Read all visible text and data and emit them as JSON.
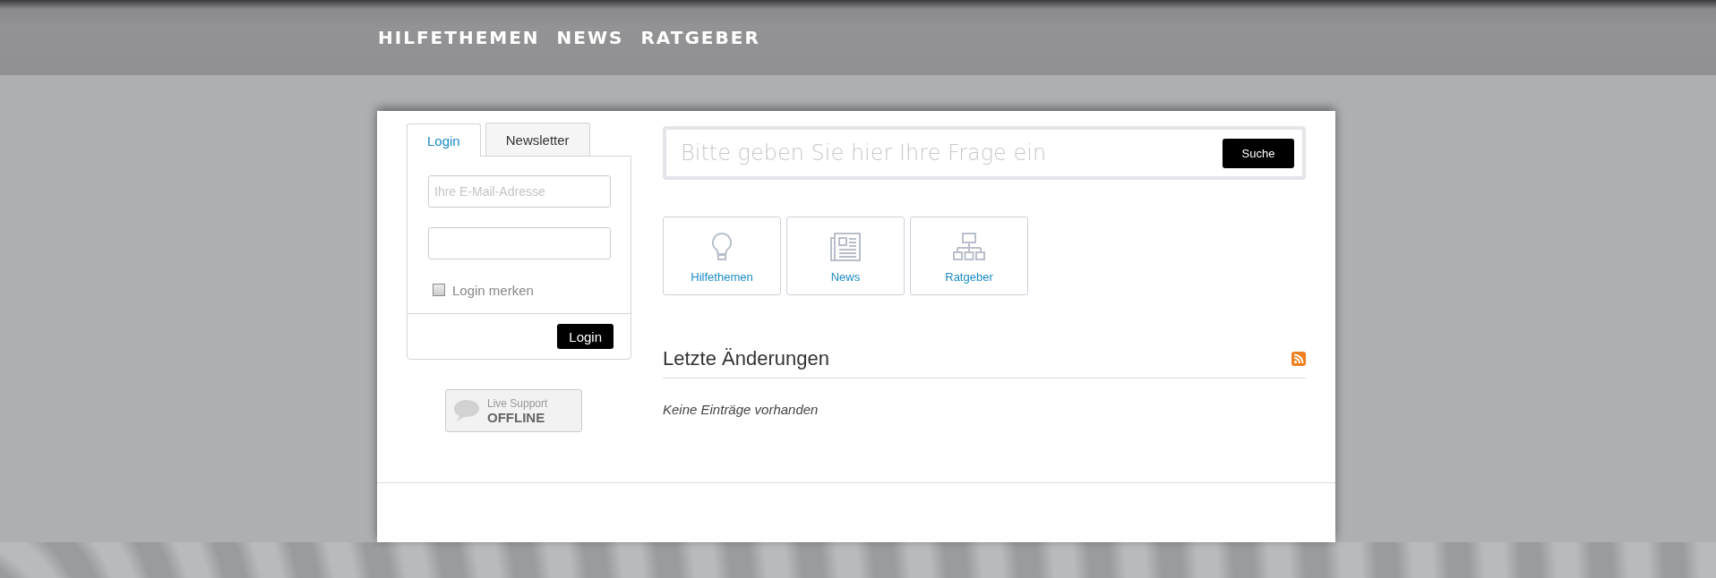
{
  "nav": [
    "HILFETHEMEN",
    "NEWS",
    "RATGEBER"
  ],
  "login_box": {
    "tabs": [
      {
        "label": "Login",
        "selected": true
      },
      {
        "label": "Newsletter",
        "selected": false
      }
    ],
    "email": {
      "placeholder": "Ihre E-Mail-Adresse"
    },
    "remember": {
      "label": "Login merken",
      "checked": false
    },
    "button": "Login"
  },
  "live_support": {
    "line_1": "Live Support",
    "line_2": "OFFLINE"
  },
  "search": {
    "placeholder": "Bitte geben Sie hier Ihre Frage ein",
    "button": "Suche"
  },
  "tiles": [
    "Hilfethemen",
    "News",
    "Ratgeber"
  ],
  "changes": {
    "title": "Letzte Änderungen",
    "empty": "Keine Einträge vorhanden"
  }
}
